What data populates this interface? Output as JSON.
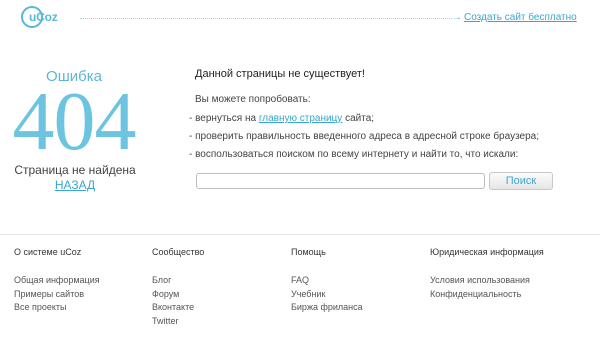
{
  "header": {
    "logo_text": "uCoz",
    "create_site_link": "Создать сайт бесплатно"
  },
  "error": {
    "title": "Ошибка",
    "code": "404",
    "subtitle": "Страница не найдена",
    "back_link": "НАЗАД"
  },
  "message": {
    "title": "Данной страницы не существует!",
    "try_text": "Вы можете попробовать:",
    "item1_prefix": "- вернуться на ",
    "item1_link": "главную страницу",
    "item1_suffix": " сайта;",
    "item2": "- проверить правильность введенного адреса в адресной строке браузера;",
    "item3": "- воспользоваться поиском по всему интернету и найти то, что искали:"
  },
  "search": {
    "value": "",
    "button_label": "Поиск"
  },
  "footer": {
    "columns": [
      {
        "heading": "О системе uCoz",
        "links": [
          "Общая информация",
          "Примеры сайтов",
          "Все проекты"
        ]
      },
      {
        "heading": "Сообщество",
        "links": [
          "Блог",
          "Форум",
          "Вконтакте",
          "Twitter"
        ]
      },
      {
        "heading": "Помощь",
        "links": [
          "FAQ",
          "Учебник",
          "Биржа фриланса"
        ]
      },
      {
        "heading": "Юридическая информация",
        "links": [
          "Условия использования",
          "Конфиденциальность"
        ]
      }
    ]
  },
  "colors": {
    "accent": "#59b8d6",
    "link": "#3aa6cf",
    "error_code": "#6cc4e0"
  }
}
